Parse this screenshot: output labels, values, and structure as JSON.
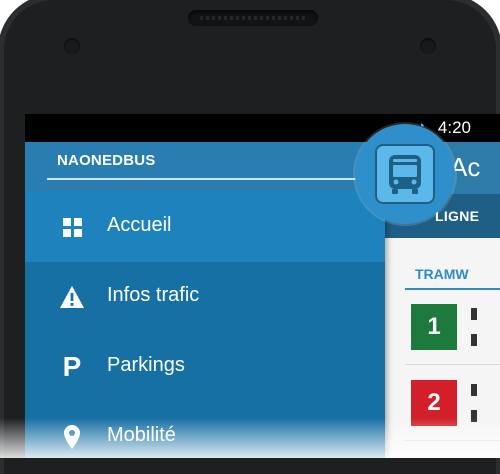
{
  "status_bar": {
    "time": "4:20"
  },
  "app": {
    "title": "Ac",
    "tab": "LIGNE",
    "section": "TRAMW"
  },
  "lines": [
    {
      "number": "1",
      "color": "#1e7a3c"
    },
    {
      "number": "2",
      "color": "#d21f2a"
    }
  ],
  "drawer": {
    "brand": "NAONEDBUS",
    "items": [
      {
        "label": "Accueil",
        "icon": "grid-icon",
        "active": true
      },
      {
        "label": "Infos trafic",
        "icon": "warning-icon",
        "active": false
      },
      {
        "label": "Parkings",
        "icon": "parking-icon",
        "active": false
      },
      {
        "label": "Mobilité",
        "icon": "location-pin-icon",
        "active": false
      }
    ]
  },
  "colors": {
    "drawer": "#1670a4",
    "active_item": "#1e82bd",
    "accent": "#2c8cc8"
  }
}
